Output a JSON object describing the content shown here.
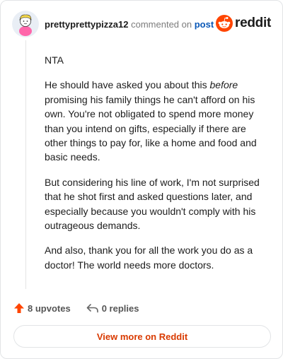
{
  "header": {
    "username": "prettyprettypizza12",
    "commented_text": "commented on",
    "post_link": "post",
    "brand": "reddit"
  },
  "comment": {
    "paragraphs": {
      "p1": "NTA",
      "p2_before": "He should have asked you about this ",
      "p2_em": "before",
      "p2_after": " promising his family things he can't afford on his own. You're not obligated to spend more money than you intend on gifts, especially if there are other things to pay for, like a home and food and basic needs.",
      "p3": "But considering his line of work, I'm not surprised that he shot first and asked questions later, and especially because you wouldn't comply with his outrageous demands.",
      "p4": "And also, thank you for all the work you do as a doctor! The world needs more doctors."
    }
  },
  "actions": {
    "upvotes": "8 upvotes",
    "replies": "0 replies"
  },
  "footer": {
    "view_more": "View more on Reddit"
  },
  "colors": {
    "upvote": "#ff4500",
    "brand": "#ff4500",
    "link": "#0a58b7",
    "view_more": "#d93a00"
  },
  "icons": {
    "avatar": "avatar-icon",
    "brand": "reddit-logo-icon",
    "upvote": "upvote-arrow-icon",
    "reply": "reply-arrow-icon"
  }
}
